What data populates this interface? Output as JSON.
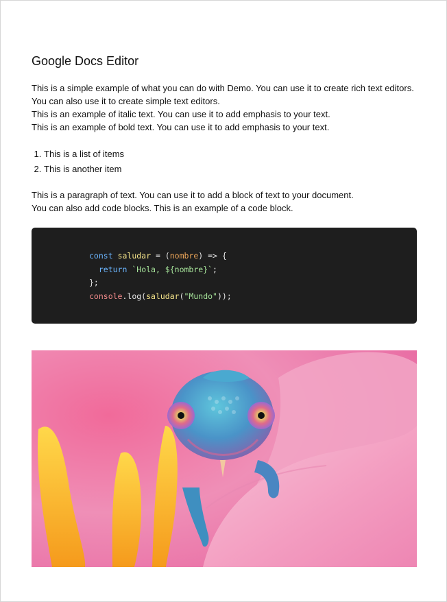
{
  "doc": {
    "title": "Google Docs Editor",
    "intro_lines": [
      "This is a simple example of what you can do with Demo. You can use it to create rich text editors. You can also use it to create simple text editors.",
      "This is an example of italic text. You can use it to add emphasis to your text.",
      "This is an example of bold text. You can use it to add emphasis to your text."
    ],
    "list_items": [
      "This is a list of items",
      "This is another item"
    ],
    "paragraph_lines": [
      "This is a paragraph of text. You can use it to add a block of text to your document.",
      "You can also add code blocks. This is an example of a code block."
    ],
    "code": {
      "line1_kw": "const",
      "line1_name": "saludar",
      "line1_eq": " = (",
      "line1_param": "nombre",
      "line1_rest": ") => {",
      "line2_kw": "return",
      "line2_str": "`Hola, ${nombre}`",
      "line2_end": ";",
      "line3": "};",
      "line4_obj": "console",
      "line4_dot": ".log(",
      "line4_fn": "saludar",
      "line4_open": "(",
      "line4_str": "\"Mundo\"",
      "line4_end": "));"
    }
  },
  "colors": {
    "code_bg": "#1e1e1e",
    "keyword": "#6cb6ff",
    "string": "#a6e39a"
  }
}
